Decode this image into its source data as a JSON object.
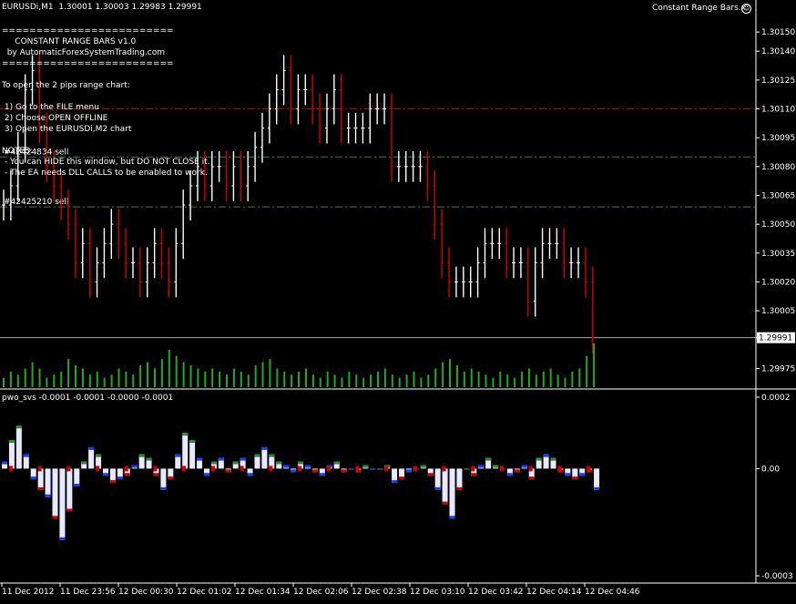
{
  "header": {
    "symbol_text": "EURUSDi,M1  1.30001 1.30003 1.29983 1.29991",
    "ea_label": "Constant Range Bars.x"
  },
  "ea_panel": {
    "lines": [
      "=========================",
      "     CONSTANT RANGE BARS v1.0",
      "  by AutomaticForexSystemTrading.com",
      "=========================",
      "",
      "To open the 2 pips range chart:",
      "",
      " 1) Go to the FILE menu",
      " 2) Choose OPEN OFFLINE",
      " 3) Open the EURUSDi,M2 chart",
      "",
      "NOTES:",
      " - You can HIDE this window, but DO NOT CLOSE it.",
      " - The EA needs DLL CALLS to be enabled to work."
    ]
  },
  "orders": [
    {
      "label": "#42424834 sell",
      "price": 1.30085,
      "color": "#2e8b2e"
    },
    {
      "label": "#42425210 sell",
      "price": 1.30059,
      "color": "#2e8b2e"
    }
  ],
  "red_line_price": 1.3011,
  "indicator_label": "pwo_svs -0.0001 -0.0001 -0.0000 -0.0001",
  "colors": {
    "bull": "#ffffff",
    "bear": "#d00000",
    "volume": "#22aa22",
    "grid": "#555555",
    "red_line": "#c00000"
  },
  "chart_data": [
    {
      "type": "line",
      "name": "price",
      "yticks": [
        "1.30150",
        "1.30140",
        "1.30125",
        "1.30110",
        "1.30095",
        "1.30080",
        "1.30065",
        "1.30050",
        "1.30035",
        "1.30020",
        "1.30005",
        "1.29991",
        "1.29975"
      ],
      "ylim": [
        1.2997,
        1.3016
      ],
      "current_price": "1.29991",
      "x": [
        0,
        8,
        16,
        24,
        32,
        40,
        48,
        56,
        64,
        72,
        80,
        88,
        96,
        104,
        112,
        120,
        128,
        136,
        144,
        152,
        160,
        168,
        176,
        184,
        192,
        200,
        208,
        216,
        224,
        232,
        240,
        248,
        256,
        264,
        272,
        280,
        288,
        296,
        304,
        312,
        320,
        328,
        336,
        344,
        352,
        360,
        368,
        376,
        384,
        392,
        400,
        408,
        416,
        424,
        432,
        440,
        448,
        456,
        464,
        472,
        480,
        488,
        496,
        504,
        512,
        520,
        528,
        536,
        544,
        552,
        560,
        568,
        576,
        584,
        592,
        600,
        608,
        616,
        624,
        632,
        640,
        648,
        656
      ],
      "close": [
        1.3006,
        1.3007,
        1.3009,
        1.3012,
        1.3013,
        1.301,
        1.3008,
        1.3007,
        1.3006,
        1.3005,
        1.3003,
        1.3004,
        1.3002,
        1.3003,
        1.3004,
        1.3005,
        1.3004,
        1.3003,
        1.3003,
        1.3002,
        1.3003,
        1.3004,
        1.3003,
        1.3002,
        1.3004,
        1.3006,
        1.3007,
        1.3008,
        1.3007,
        1.3008,
        1.3008,
        1.3007,
        1.3008,
        1.3007,
        1.3008,
        1.3009,
        1.301,
        1.3011,
        1.3012,
        1.3013,
        1.3011,
        1.3012,
        1.3012,
        1.3011,
        1.301,
        1.3011,
        1.3012,
        1.301,
        1.301,
        1.301,
        1.301,
        1.3011,
        1.3011,
        1.3011,
        1.3008,
        1.3008,
        1.3008,
        1.3008,
        1.3008,
        1.3007,
        1.3005,
        1.3003,
        1.3002,
        1.3002,
        1.3002,
        1.3002,
        1.3003,
        1.3004,
        1.3004,
        1.3004,
        1.3003,
        1.3003,
        1.3003,
        1.3001,
        1.3003,
        1.3004,
        1.3004,
        1.3004,
        1.3003,
        1.3003,
        1.3003,
        1.3002,
        1.29991
      ]
    },
    {
      "type": "bar",
      "name": "volume",
      "values": [
        3,
        5,
        4,
        6,
        8,
        6,
        3,
        4,
        5,
        9,
        7,
        6,
        4,
        5,
        3,
        4,
        6,
        5,
        4,
        7,
        8,
        6,
        9,
        12,
        10,
        8,
        7,
        6,
        5,
        6,
        5,
        4,
        6,
        5,
        4,
        7,
        8,
        9,
        6,
        5,
        4,
        5,
        6,
        4,
        3,
        5,
        4,
        3,
        5,
        4,
        3,
        4,
        5,
        6,
        4,
        3,
        4,
        5,
        3,
        4,
        6,
        8,
        9,
        7,
        5,
        6,
        5,
        4,
        3,
        5,
        4,
        3,
        5,
        6,
        4,
        5,
        6,
        4,
        3,
        5,
        6,
        10,
        14
      ]
    },
    {
      "type": "bar",
      "name": "pwo_svs",
      "yticks": [
        "0.0002",
        "0.00",
        "-0.0003"
      ],
      "ylim": [
        -0.0003,
        0.0002
      ],
      "values": [
        2e-05,
        8e-05,
        0.00012,
        4e-05,
        -3e-05,
        -6e-05,
        -8e-05,
        -0.00014,
        -0.0002,
        -0.00012,
        -5e-05,
        2e-05,
        6e-05,
        4e-05,
        -2e-05,
        -4e-05,
        -3e-05,
        -2e-05,
        1e-05,
        4e-05,
        3e-05,
        -2e-05,
        -6e-05,
        -3e-05,
        4e-05,
        0.0001,
        8e-05,
        3e-05,
        -2e-05,
        2e-05,
        3e-05,
        -1e-05,
        2e-05,
        3e-05,
        -2e-05,
        4e-05,
        6e-05,
        4e-05,
        2e-05,
        1e-05,
        -1e-05,
        2e-05,
        1e-05,
        -1e-05,
        -2e-05,
        1e-05,
        2e-05,
        -1e-05,
        0.0,
        -1e-05,
        1e-05,
        0.0,
        0.0,
        1e-05,
        -4e-05,
        -3e-05,
        -1e-05,
        0.0,
        1e-05,
        -2e-05,
        -6e-05,
        -0.0001,
        -0.00014,
        -6e-05,
        0.0,
        -2e-05,
        1e-05,
        3e-05,
        1e-05,
        0.0,
        -2e-05,
        -1e-05,
        1e-05,
        -3e-05,
        3e-05,
        4e-05,
        3e-05,
        -1e-05,
        -2e-05,
        -3e-05,
        -2e-05,
        -1e-05,
        -6e-05
      ]
    }
  ],
  "x_axis_labels": [
    "11 Dec 2012",
    "11 Dec 23:56",
    "12 Dec 00:30",
    "12 Dec 01:02",
    "12 Dec 01:34",
    "12 Dec 02:06",
    "12 Dec 02:38",
    "12 Dec 03:10",
    "12 Dec 03:42",
    "12 Dec 04:14",
    "12 Dec 04:46"
  ]
}
